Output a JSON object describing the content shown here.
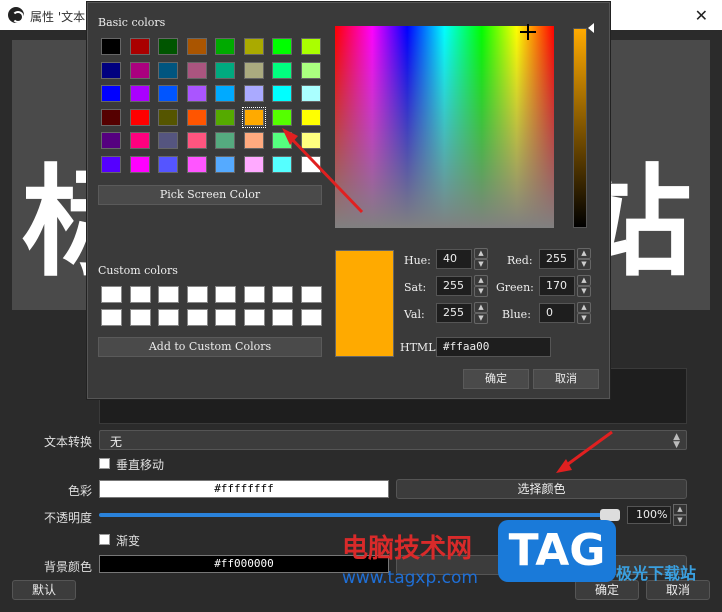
{
  "window": {
    "title": "属性 '文本"
  },
  "preview": {
    "left_char": "标",
    "right_char": "站"
  },
  "props": {
    "text_transform_label": "文本转换",
    "text_transform_value": "无",
    "vertical_label": "垂直移动",
    "color_label": "色彩",
    "color_value": "#ffffffff",
    "pick_color_button": "选择颜色",
    "opacity_label": "不透明度",
    "opacity_value": "100%",
    "gradient_label": "渐变",
    "bg_color_label": "背景颜色",
    "bg_color_value": "#ff000000",
    "bg_pick_button": "选择颜色"
  },
  "footer": {
    "defaults_button": "默认",
    "ok_button": "确定",
    "cancel_button": "取消"
  },
  "watermark": {
    "line1": "电脑技术网",
    "line2": "www.tagxp.com",
    "logo": "TAG",
    "corner": "极光下载站"
  },
  "dialog": {
    "basic_colors_label": "Basic colors",
    "pick_screen_color": "Pick Screen Color",
    "custom_colors_label": "Custom colors",
    "add_custom_colors": "Add to Custom Colors",
    "hue_label": "Hue:",
    "hue": "40",
    "sat_label": "Sat:",
    "sat": "255",
    "val_label": "Val:",
    "val": "255",
    "red_label": "Red:",
    "red": "255",
    "green_label": "Green:",
    "green": "170",
    "blue_label": "Blue:",
    "blue": "0",
    "html_label": "HTML:",
    "html": "#ffaa00",
    "ok_button": "确定",
    "cancel_button": "取消",
    "current_color": "#ffaa00",
    "basic_colors": [
      [
        "#000000",
        "#aa0000",
        "#005500",
        "#aa5500",
        "#00aa00",
        "#aaaa00",
        "#00ff00",
        "#aaff00"
      ],
      [
        "#00007f",
        "#aa007f",
        "#00557f",
        "#aa557f",
        "#00aa7f",
        "#aaaa7f",
        "#00ff7f",
        "#aaff7f"
      ],
      [
        "#0000ff",
        "#aa00ff",
        "#0055ff",
        "#aa55ff",
        "#00aaff",
        "#aaaaff",
        "#00ffff",
        "#aaffff"
      ],
      [
        "#550000",
        "#ff0000",
        "#555500",
        "#ff5500",
        "#55aa00",
        "#ffaa00",
        "#55ff00",
        "#ffff00"
      ],
      [
        "#55007f",
        "#ff007f",
        "#55557f",
        "#ff557f",
        "#55aa7f",
        "#ffaa7f",
        "#55ff7f",
        "#ffff7f"
      ],
      [
        "#5500ff",
        "#ff00ff",
        "#5555ff",
        "#ff55ff",
        "#55aaff",
        "#ffaaff",
        "#55ffff",
        "#ffffff"
      ]
    ],
    "selected_swatch": [
      3,
      5
    ]
  },
  "accent": {
    "arrow": "#e02020",
    "slider": "#2a82da"
  }
}
